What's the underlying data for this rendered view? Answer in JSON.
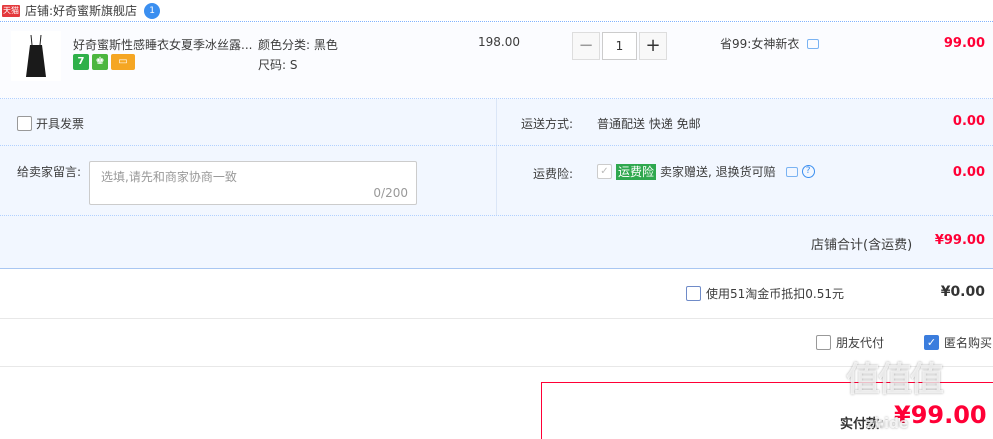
{
  "shop": {
    "badge": "天猫",
    "label": "店铺:",
    "name": "好奇蜜斯旗舰店",
    "ww_icon": "1"
  },
  "item": {
    "title": "好奇蜜斯性感睡衣女夏季冰丝露...",
    "sku_color": "颜色分类:  黑色",
    "sku_size": "尺码:  S",
    "price": "198.00",
    "quantity": "1",
    "promo": "省99:女神新衣",
    "subtotal": "99.00",
    "service_icons": [
      "seven-day-return-icon",
      "guarantee-icon",
      "credit-card-icon"
    ],
    "service_icon_text": [
      "7",
      "♚",
      "▭"
    ]
  },
  "extras": {
    "invoice_label": "开具发票",
    "shipping_label": "运送方式:",
    "shipping_value": "普通配送 快递 免邮",
    "shipping_fee": "0.00",
    "memo_label": "给卖家留言:",
    "memo_placeholder": "选填,请先和商家协商一致",
    "memo_count": "0/200",
    "insurance_label": "运费险:",
    "insurance_badge": "运费险",
    "insurance_text": "卖家赠送, 退换货可赔",
    "insurance_fee": "0.00",
    "total_label": "店铺合计(含运费)",
    "total_value": "¥99.00"
  },
  "coin": {
    "label": "使用51淘金币抵扣0.51元",
    "value": "¥0.00"
  },
  "options": {
    "friend_pay": "朋友代付",
    "anonymous": "匿名购买"
  },
  "payment": {
    "label": "实付款:",
    "value": "¥99.00"
  },
  "watermark": {
    "main": "值值值",
    "sub": "zhide"
  },
  "colors": {
    "accent_red": "#ff0036",
    "link_blue": "#3b8ff0",
    "panel_bg": "#f2f7ff"
  }
}
